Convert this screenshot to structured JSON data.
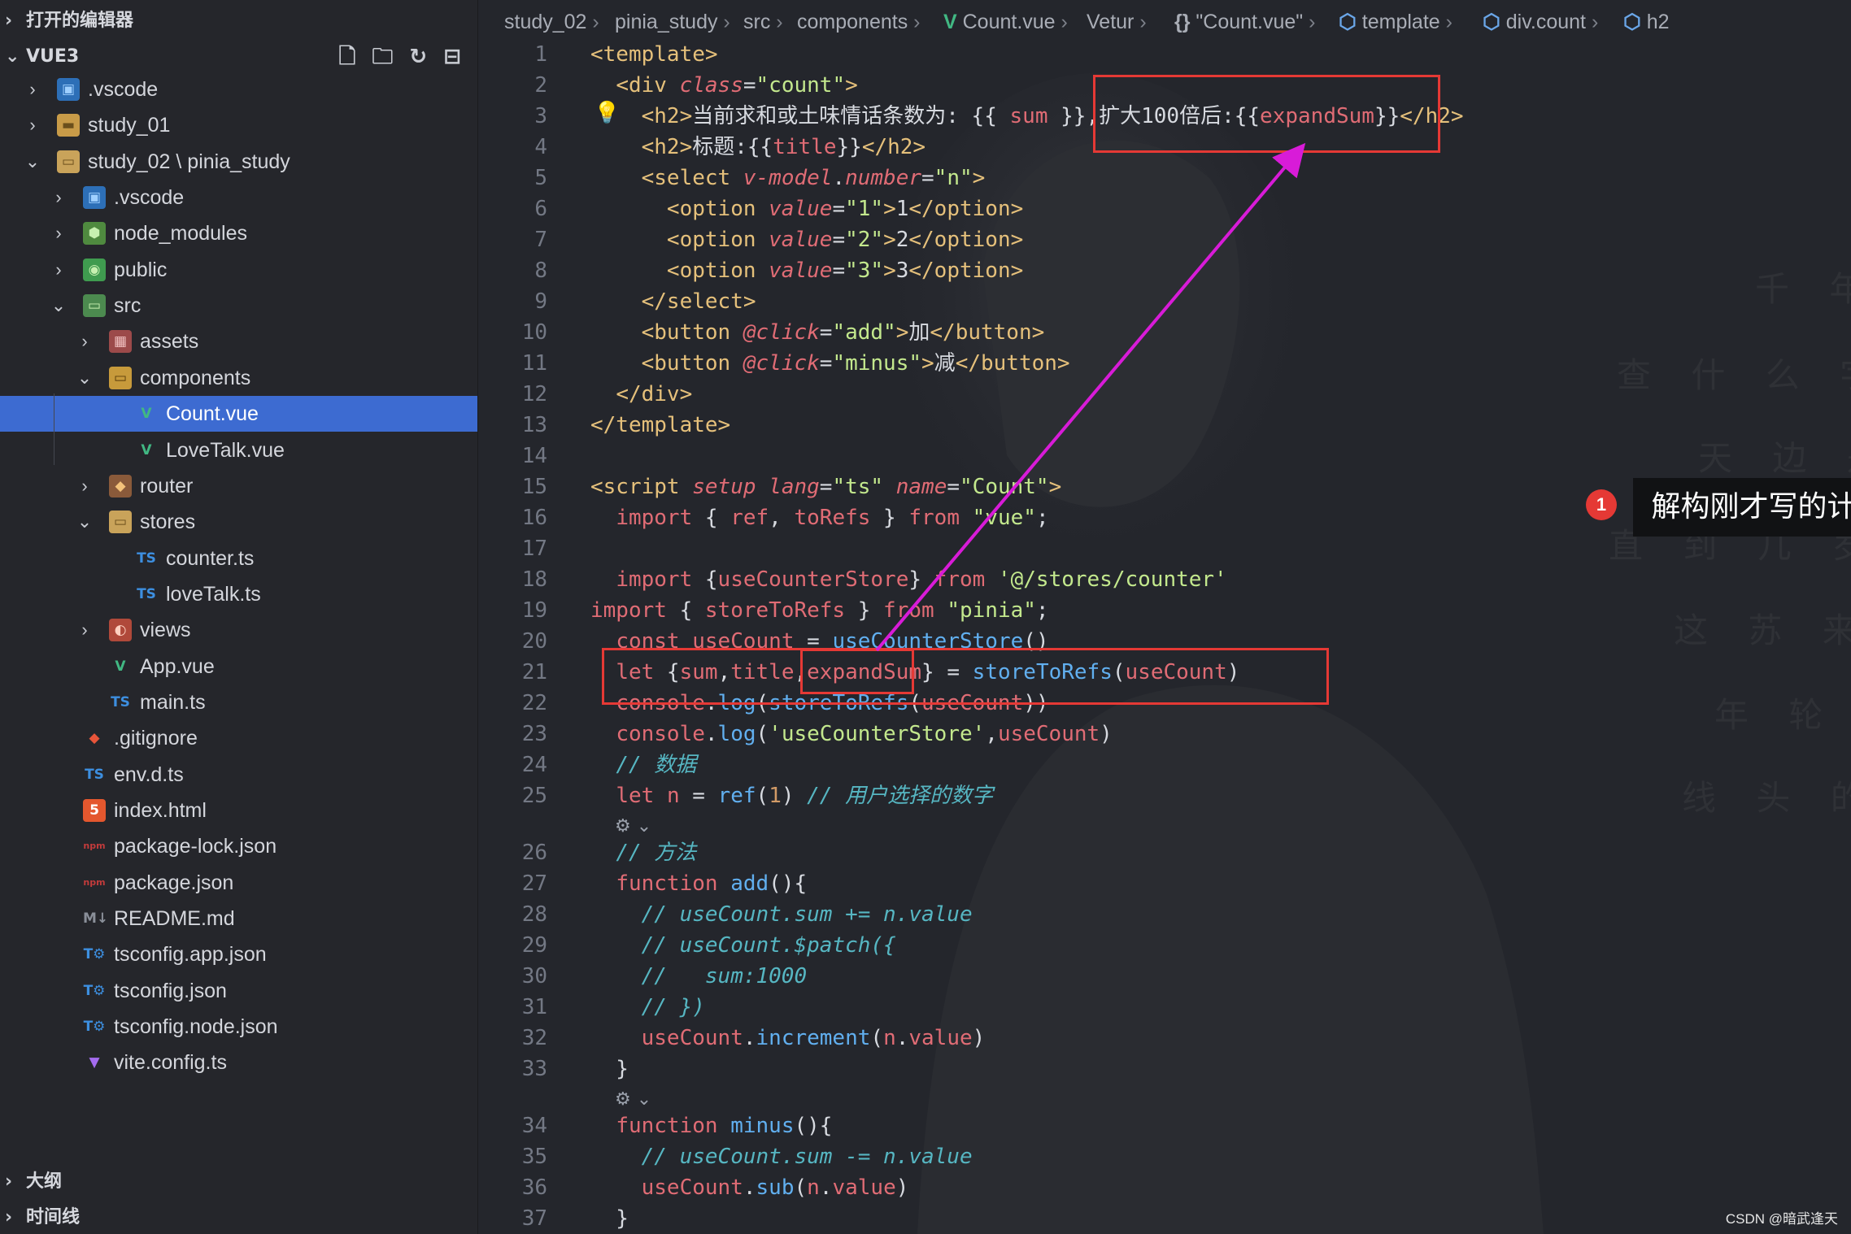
{
  "sidebar": {
    "open_editors_title": "打开的编辑器",
    "workspace_title": "VUE3",
    "outline_title": "大纲",
    "timeline_title": "时间线",
    "tree": [
      {
        "label": ".vscode",
        "icon": "vscode-folder-icon",
        "arrow": "›",
        "depth": 0
      },
      {
        "label": "study_01",
        "icon": "folder-icon",
        "arrow": "›",
        "depth": 0
      },
      {
        "label": "study_02 \\ pinia_study",
        "icon": "folder-open-icon",
        "arrow": "⌄",
        "depth": 0
      },
      {
        "label": ".vscode",
        "icon": "vscode-folder-icon",
        "arrow": "›",
        "depth": 1
      },
      {
        "label": "node_modules",
        "icon": "node-folder-icon",
        "arrow": "›",
        "depth": 1
      },
      {
        "label": "public",
        "icon": "public-folder-icon",
        "arrow": "›",
        "depth": 1
      },
      {
        "label": "src",
        "icon": "src-folder-icon",
        "arrow": "⌄",
        "depth": 1
      },
      {
        "label": "assets",
        "icon": "assets-folder-icon",
        "arrow": "›",
        "depth": 2
      },
      {
        "label": "components",
        "icon": "components-folder-icon",
        "arrow": "⌄",
        "depth": 2
      },
      {
        "label": "Count.vue",
        "icon": "vue-icon",
        "arrow": "",
        "depth": 3,
        "selected": true
      },
      {
        "label": "LoveTalk.vue",
        "icon": "vue-icon",
        "arrow": "",
        "depth": 3
      },
      {
        "label": "router",
        "icon": "router-folder-icon",
        "arrow": "›",
        "depth": 2
      },
      {
        "label": "stores",
        "icon": "folder-open-icon",
        "arrow": "⌄",
        "depth": 2
      },
      {
        "label": "counter.ts",
        "icon": "ts-icon",
        "arrow": "",
        "depth": 3
      },
      {
        "label": "loveTalk.ts",
        "icon": "ts-icon",
        "arrow": "",
        "depth": 3
      },
      {
        "label": "views",
        "icon": "views-folder-icon",
        "arrow": "›",
        "depth": 2
      },
      {
        "label": "App.vue",
        "icon": "vue-icon",
        "arrow": "",
        "depth": 2
      },
      {
        "label": "main.ts",
        "icon": "ts-icon",
        "arrow": "",
        "depth": 2
      },
      {
        "label": ".gitignore",
        "icon": "git-icon",
        "arrow": "",
        "depth": 1
      },
      {
        "label": "env.d.ts",
        "icon": "ts-icon",
        "arrow": "",
        "depth": 1
      },
      {
        "label": "index.html",
        "icon": "html-icon",
        "arrow": "",
        "depth": 1
      },
      {
        "label": "package-lock.json",
        "icon": "npm-icon",
        "arrow": "",
        "depth": 1
      },
      {
        "label": "package.json",
        "icon": "npm-icon",
        "arrow": "",
        "depth": 1
      },
      {
        "label": "README.md",
        "icon": "markdown-icon",
        "arrow": "",
        "depth": 1
      },
      {
        "label": "tsconfig.app.json",
        "icon": "tsconfig-icon",
        "arrow": "",
        "depth": 1
      },
      {
        "label": "tsconfig.json",
        "icon": "tsconfig-icon",
        "arrow": "",
        "depth": 1
      },
      {
        "label": "tsconfig.node.json",
        "icon": "tsconfig-icon",
        "arrow": "",
        "depth": 1
      },
      {
        "label": "vite.config.ts",
        "icon": "vite-icon",
        "arrow": "",
        "depth": 1
      }
    ]
  },
  "breadcrumb": [
    {
      "text": "study_02",
      "icon": ""
    },
    {
      "text": "pinia_study",
      "icon": ""
    },
    {
      "text": "src",
      "icon": ""
    },
    {
      "text": "components",
      "icon": ""
    },
    {
      "text": "Count.vue",
      "icon": "vue-icon"
    },
    {
      "text": "Vetur",
      "icon": ""
    },
    {
      "text": "\"Count.vue\"",
      "icon": "braces-icon"
    },
    {
      "text": "template",
      "icon": "cube-icon"
    },
    {
      "text": "div.count",
      "icon": "cube-icon"
    },
    {
      "text": "h2",
      "icon": "cube-icon"
    }
  ],
  "code": [
    {
      "n": "1",
      "t": [
        [
          "tag",
          "<template>"
        ]
      ]
    },
    {
      "n": "2",
      "t": [
        [
          "txt",
          "  "
        ],
        [
          "tag",
          "<div "
        ],
        [
          "attr",
          "class"
        ],
        [
          "txt",
          "="
        ],
        [
          "str",
          "\"count\""
        ],
        [
          "tag",
          ">"
        ]
      ]
    },
    {
      "n": "3",
      "t": [
        [
          "txt",
          "    "
        ],
        [
          "tag",
          "<h2>"
        ],
        [
          "txt",
          "当前求和或土味情话条数为: {{ "
        ],
        [
          "var",
          "sum"
        ],
        [
          "txt",
          " }},扩大100倍后:{{"
        ],
        [
          "var",
          "expandSum"
        ],
        [
          "txt",
          "}}"
        ],
        [
          "tag",
          "</h2>"
        ]
      ]
    },
    {
      "n": "4",
      "t": [
        [
          "txt",
          "    "
        ],
        [
          "tag",
          "<h2>"
        ],
        [
          "txt",
          "标题:{{"
        ],
        [
          "var",
          "title"
        ],
        [
          "txt",
          "}}"
        ],
        [
          "tag",
          "</h2>"
        ]
      ]
    },
    {
      "n": "5",
      "t": [
        [
          "txt",
          "    "
        ],
        [
          "tag",
          "<select "
        ],
        [
          "attr",
          "v-model"
        ],
        [
          "txt",
          "."
        ],
        [
          "attr",
          "number"
        ],
        [
          "txt",
          "="
        ],
        [
          "str",
          "\"n\""
        ],
        [
          "tag",
          ">"
        ]
      ]
    },
    {
      "n": "6",
      "t": [
        [
          "txt",
          "      "
        ],
        [
          "tag",
          "<option "
        ],
        [
          "attr",
          "value"
        ],
        [
          "txt",
          "="
        ],
        [
          "str",
          "\"1\""
        ],
        [
          "tag",
          ">"
        ],
        [
          "txt",
          "1"
        ],
        [
          "tag",
          "</option>"
        ]
      ]
    },
    {
      "n": "7",
      "t": [
        [
          "txt",
          "      "
        ],
        [
          "tag",
          "<option "
        ],
        [
          "attr",
          "value"
        ],
        [
          "txt",
          "="
        ],
        [
          "str",
          "\"2\""
        ],
        [
          "tag",
          ">"
        ],
        [
          "txt",
          "2"
        ],
        [
          "tag",
          "</option>"
        ]
      ]
    },
    {
      "n": "8",
      "t": [
        [
          "txt",
          "      "
        ],
        [
          "tag",
          "<option "
        ],
        [
          "attr",
          "value"
        ],
        [
          "txt",
          "="
        ],
        [
          "str",
          "\"3\""
        ],
        [
          "tag",
          ">"
        ],
        [
          "txt",
          "3"
        ],
        [
          "tag",
          "</option>"
        ]
      ]
    },
    {
      "n": "9",
      "t": [
        [
          "txt",
          "    "
        ],
        [
          "tag",
          "</select>"
        ]
      ]
    },
    {
      "n": "10",
      "t": [
        [
          "txt",
          "    "
        ],
        [
          "tag",
          "<button "
        ],
        [
          "attr",
          "@click"
        ],
        [
          "txt",
          "="
        ],
        [
          "str",
          "\"add\""
        ],
        [
          "tag",
          ">"
        ],
        [
          "txt",
          "加"
        ],
        [
          "tag",
          "</button>"
        ]
      ]
    },
    {
      "n": "11",
      "t": [
        [
          "txt",
          "    "
        ],
        [
          "tag",
          "<button "
        ],
        [
          "attr",
          "@click"
        ],
        [
          "txt",
          "="
        ],
        [
          "str",
          "\"minus\""
        ],
        [
          "tag",
          ">"
        ],
        [
          "txt",
          "减"
        ],
        [
          "tag",
          "</button>"
        ]
      ]
    },
    {
      "n": "12",
      "t": [
        [
          "txt",
          "  "
        ],
        [
          "tag",
          "</div>"
        ]
      ]
    },
    {
      "n": "13",
      "t": [
        [
          "tag",
          "</template>"
        ]
      ]
    },
    {
      "n": "14",
      "t": []
    },
    {
      "n": "15",
      "t": [
        [
          "tag",
          "<script "
        ],
        [
          "attr",
          "setup"
        ],
        [
          "txt",
          " "
        ],
        [
          "attr",
          "lang"
        ],
        [
          "txt",
          "="
        ],
        [
          "str",
          "\"ts\""
        ],
        [
          "txt",
          " "
        ],
        [
          "attr",
          "name"
        ],
        [
          "txt",
          "="
        ],
        [
          "str",
          "\"Count\""
        ],
        [
          "tag",
          ">"
        ]
      ]
    },
    {
      "n": "16",
      "t": [
        [
          "txt",
          "  "
        ],
        [
          "kw",
          "import"
        ],
        [
          "txt",
          " { "
        ],
        [
          "var",
          "ref"
        ],
        [
          "txt",
          ", "
        ],
        [
          "var",
          "toRefs"
        ],
        [
          "txt",
          " } "
        ],
        [
          "kw",
          "from"
        ],
        [
          "txt",
          " "
        ],
        [
          "str",
          "\"vue\""
        ],
        [
          "txt",
          ";"
        ]
      ]
    },
    {
      "n": "17",
      "t": []
    },
    {
      "n": "18",
      "t": [
        [
          "txt",
          "  "
        ],
        [
          "kw",
          "import"
        ],
        [
          "txt",
          " {"
        ],
        [
          "var",
          "useCounterStore"
        ],
        [
          "txt",
          "} "
        ],
        [
          "kw",
          "from"
        ],
        [
          "txt",
          " "
        ],
        [
          "str",
          "'@/stores/counter'"
        ]
      ]
    },
    {
      "n": "19",
      "t": [
        [
          "kw",
          "import"
        ],
        [
          "txt",
          " { "
        ],
        [
          "var",
          "storeToRefs"
        ],
        [
          "txt",
          " } "
        ],
        [
          "kw",
          "from"
        ],
        [
          "txt",
          " "
        ],
        [
          "str",
          "\"pinia\""
        ],
        [
          "txt",
          ";"
        ]
      ]
    },
    {
      "n": "20",
      "t": [
        [
          "txt",
          "  "
        ],
        [
          "kw",
          "const"
        ],
        [
          "txt",
          " "
        ],
        [
          "var",
          "useCount"
        ],
        [
          "txt",
          " = "
        ],
        [
          "fn",
          "useCounterStore"
        ],
        [
          "txt",
          "()"
        ]
      ]
    },
    {
      "n": "21",
      "t": [
        [
          "txt",
          "  "
        ],
        [
          "kw",
          "let"
        ],
        [
          "txt",
          " {"
        ],
        [
          "var",
          "sum"
        ],
        [
          "txt",
          ","
        ],
        [
          "var",
          "title"
        ],
        [
          "txt",
          ","
        ],
        [
          "var",
          "expandSum"
        ],
        [
          "txt",
          "} = "
        ],
        [
          "fn",
          "storeToRefs"
        ],
        [
          "txt",
          "("
        ],
        [
          "var",
          "useCount"
        ],
        [
          "txt",
          ")"
        ]
      ]
    },
    {
      "n": "22",
      "t": [
        [
          "txt",
          "  "
        ],
        [
          "var",
          "console"
        ],
        [
          "txt",
          "."
        ],
        [
          "fn",
          "log"
        ],
        [
          "txt",
          "("
        ],
        [
          "fn",
          "storeToRefs"
        ],
        [
          "txt",
          "("
        ],
        [
          "var",
          "useCount"
        ],
        [
          "txt",
          "))"
        ]
      ]
    },
    {
      "n": "23",
      "t": [
        [
          "txt",
          "  "
        ],
        [
          "var",
          "console"
        ],
        [
          "txt",
          "."
        ],
        [
          "fn",
          "log"
        ],
        [
          "txt",
          "("
        ],
        [
          "str",
          "'useCounterStore'"
        ],
        [
          "txt",
          ","
        ],
        [
          "var",
          "useCount"
        ],
        [
          "txt",
          ")"
        ]
      ]
    },
    {
      "n": "24",
      "t": [
        [
          "txt",
          "  "
        ],
        [
          "cmt",
          "// 数据"
        ]
      ]
    },
    {
      "n": "25",
      "t": [
        [
          "txt",
          "  "
        ],
        [
          "kw",
          "let"
        ],
        [
          "txt",
          " "
        ],
        [
          "var",
          "n"
        ],
        [
          "txt",
          " = "
        ],
        [
          "fn",
          "ref"
        ],
        [
          "txt",
          "("
        ],
        [
          "num",
          "1"
        ],
        [
          "txt",
          ") "
        ],
        [
          "cmt",
          "// 用户选择的数字"
        ]
      ]
    },
    {
      "lens": true
    },
    {
      "n": "26",
      "t": [
        [
          "txt",
          "  "
        ],
        [
          "cmt",
          "// 方法"
        ]
      ]
    },
    {
      "n": "27",
      "t": [
        [
          "txt",
          "  "
        ],
        [
          "kw",
          "function"
        ],
        [
          "txt",
          " "
        ],
        [
          "fn",
          "add"
        ],
        [
          "txt",
          "(){"
        ]
      ]
    },
    {
      "n": "28",
      "t": [
        [
          "txt",
          "    "
        ],
        [
          "cmt",
          "// useCount.sum += n.value"
        ]
      ]
    },
    {
      "n": "29",
      "t": [
        [
          "txt",
          "    "
        ],
        [
          "cmt",
          "// useCount.$patch({"
        ]
      ]
    },
    {
      "n": "30",
      "t": [
        [
          "txt",
          "    "
        ],
        [
          "cmt",
          "//   sum:1000"
        ]
      ]
    },
    {
      "n": "31",
      "t": [
        [
          "txt",
          "    "
        ],
        [
          "cmt",
          "// })"
        ]
      ]
    },
    {
      "n": "32",
      "t": [
        [
          "txt",
          "    "
        ],
        [
          "var",
          "useCount"
        ],
        [
          "txt",
          "."
        ],
        [
          "fn",
          "increment"
        ],
        [
          "txt",
          "("
        ],
        [
          "var",
          "n"
        ],
        [
          "txt",
          "."
        ],
        [
          "var",
          "value"
        ],
        [
          "txt",
          ")"
        ]
      ]
    },
    {
      "n": "33",
      "t": [
        [
          "txt",
          "  }"
        ]
      ]
    },
    {
      "lens": true
    },
    {
      "n": "34",
      "t": [
        [
          "txt",
          "  "
        ],
        [
          "kw",
          "function"
        ],
        [
          "txt",
          " "
        ],
        [
          "fn",
          "minus"
        ],
        [
          "txt",
          "(){"
        ]
      ]
    },
    {
      "n": "35",
      "t": [
        [
          "txt",
          "    "
        ],
        [
          "cmt",
          "// useCount.sum -= n.value"
        ]
      ]
    },
    {
      "n": "36",
      "t": [
        [
          "txt",
          "    "
        ],
        [
          "var",
          "useCount"
        ],
        [
          "txt",
          "."
        ],
        [
          "fn",
          "sub"
        ],
        [
          "txt",
          "("
        ],
        [
          "var",
          "n"
        ],
        [
          "txt",
          "."
        ],
        [
          "var",
          "value"
        ],
        [
          "txt",
          ")"
        ]
      ]
    },
    {
      "n": "37",
      "t": [
        [
          "txt",
          "  }"
        ]
      ]
    }
  ],
  "code_lens_icon": "gear-lens-icon",
  "annotation": {
    "number": "1",
    "label": "解构刚才写的计算方法",
    "color": "#e53935",
    "arrow_color": "#d81bd8"
  },
  "watermark": "CSDN @暗武逢天",
  "bg_poem": [
    "千 年 前",
    "查 什 么 字 眼 和",
    "天 边 是",
    "直 到 几 岁",
    "这 苏 来",
    "年 轮 布",
    "线 头 的 另 一 端"
  ],
  "colors": {
    "sidebar_bg": "#25262b",
    "selection": "#3d6bd1",
    "editor_bg": "#24262c",
    "tag": "#e5c07b",
    "string": "#c3e88d",
    "keyword": "#e06c75",
    "comment": "#56b6c2",
    "function": "#61afef"
  }
}
